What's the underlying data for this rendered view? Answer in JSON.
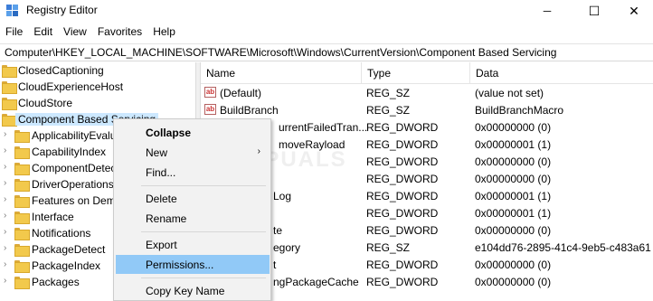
{
  "window": {
    "title": "Registry Editor",
    "minimize_glyph": "─",
    "maximize_glyph": "☐",
    "close_glyph": "✕"
  },
  "menu": [
    "File",
    "Edit",
    "View",
    "Favorites",
    "Help"
  ],
  "address": "Computer\\HKEY_LOCAL_MACHINE\\SOFTWARE\\Microsoft\\Windows\\CurrentVersion\\Component Based Servicing",
  "tree": {
    "items": [
      {
        "label": "ClosedCaptioning",
        "expandable": false
      },
      {
        "label": "CloudExperienceHost",
        "expandable": false
      },
      {
        "label": "CloudStore",
        "expandable": false
      },
      {
        "label": "Component Based Servicing",
        "expandable": false,
        "selected": true
      },
      {
        "label": "ApplicabilityEvalu",
        "expandable": true
      },
      {
        "label": "CapabilityIndex",
        "expandable": true
      },
      {
        "label": "ComponentDetec",
        "expandable": true
      },
      {
        "label": "DriverOperations",
        "expandable": true
      },
      {
        "label": "Features on Dem",
        "expandable": true
      },
      {
        "label": "Interface",
        "expandable": true
      },
      {
        "label": "Notifications",
        "expandable": true
      },
      {
        "label": "PackageDetect",
        "expandable": true
      },
      {
        "label": "PackageIndex",
        "expandable": true
      },
      {
        "label": "Packages",
        "expandable": true
      }
    ],
    "expand_glyph": "›"
  },
  "list": {
    "headers": {
      "name": "Name",
      "type": "Type",
      "data": "Data"
    },
    "icon_glyph": "ab",
    "rows": [
      {
        "name": "(Default)",
        "type": "REG_SZ",
        "data": "(value not set)",
        "icon": "string-value-icon"
      },
      {
        "name": "BuildBranch",
        "type": "REG_SZ",
        "data": "BuildBranchMacro",
        "icon": "string-value-icon"
      },
      {
        "name": "urrentFailedTran...",
        "type": "REG_DWORD",
        "data": "0x00000000 (0)"
      },
      {
        "name": "moveRayload",
        "type": "REG_DWORD",
        "data": "0x00000001 (1)"
      },
      {
        "name": "",
        "type": "REG_DWORD",
        "data": "0x00000000 (0)"
      },
      {
        "name": "",
        "type": "REG_DWORD",
        "data": "0x00000000 (0)"
      },
      {
        "name": "Log",
        "type": "REG_DWORD",
        "data": "0x00000001 (1)"
      },
      {
        "name": "",
        "type": "REG_DWORD",
        "data": "0x00000001 (1)"
      },
      {
        "name": "te",
        "type": "REG_DWORD",
        "data": "0x00000000 (0)"
      },
      {
        "name": "egory",
        "type": "REG_SZ",
        "data": "e104dd76-2895-41c4-9eb5-c483a61"
      },
      {
        "name": "t",
        "type": "REG_DWORD",
        "data": "0x00000000 (0)"
      },
      {
        "name": "ngPackageCache",
        "type": "REG_DWORD",
        "data": "0x00000000 (0)"
      }
    ]
  },
  "context_menu": {
    "items": [
      {
        "label": "Collapse",
        "bold": true
      },
      {
        "label": "New",
        "submenu": true
      },
      {
        "label": "Find..."
      },
      {
        "label": "Delete"
      },
      {
        "label": "Rename"
      },
      {
        "label": "Export"
      },
      {
        "label": "Permissions...",
        "highlighted": true
      },
      {
        "label": "Copy Key Name"
      }
    ],
    "submenu_glyph": "›"
  },
  "watermark": "APPUALS"
}
